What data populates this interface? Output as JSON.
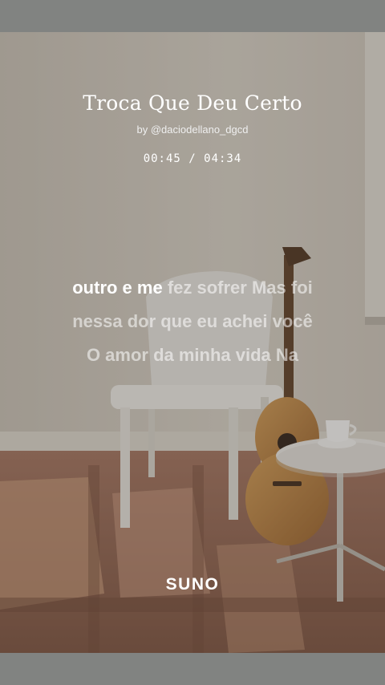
{
  "song": {
    "title": "Troca Que Deu Certo",
    "byline": "by @daciodellano_dgcd",
    "elapsed": "00:45",
    "separator": " / ",
    "duration": "04:34"
  },
  "lyrics": {
    "line1": {
      "sung": "outro e me",
      "unsung": " fez sofrer Mas foi"
    },
    "line2": "nessa dor que eu achei você",
    "line3": "O amor da minha vida Na"
  },
  "brand": {
    "name": "SUNO"
  },
  "colors": {
    "sung_text": "#ffffff",
    "unsung_text": "#ffffffa0",
    "letterbox": "#818381"
  }
}
